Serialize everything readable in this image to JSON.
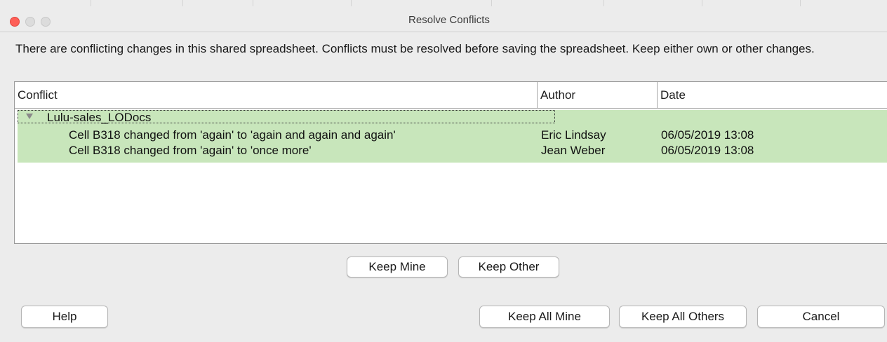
{
  "window": {
    "title": "Resolve Conflicts"
  },
  "description": "There are conflicting changes in this shared spreadsheet. Conflicts must be resolved before saving the spreadsheet. Keep either own or other changes.",
  "table": {
    "columns": [
      "Conflict",
      "Author",
      "Date"
    ],
    "group": {
      "label": "Lulu-sales_LODocs",
      "expanded": true,
      "rows": [
        {
          "conflict": "Cell B318 changed from 'again' to 'again and again and again'",
          "author": "Eric Lindsay",
          "date": "06/05/2019 13:08"
        },
        {
          "conflict": "Cell B318 changed from 'again' to 'once more'",
          "author": "Jean Weber",
          "date": "06/05/2019 13:08"
        }
      ]
    }
  },
  "buttons": {
    "keep_mine": "Keep Mine",
    "keep_other": "Keep Other",
    "help": "Help",
    "keep_all_mine": "Keep All Mine",
    "keep_all_others": "Keep All Others",
    "cancel": "Cancel"
  },
  "colors": {
    "conflict_highlight": "#c8e6bb",
    "close_light": "#fe5f57"
  }
}
